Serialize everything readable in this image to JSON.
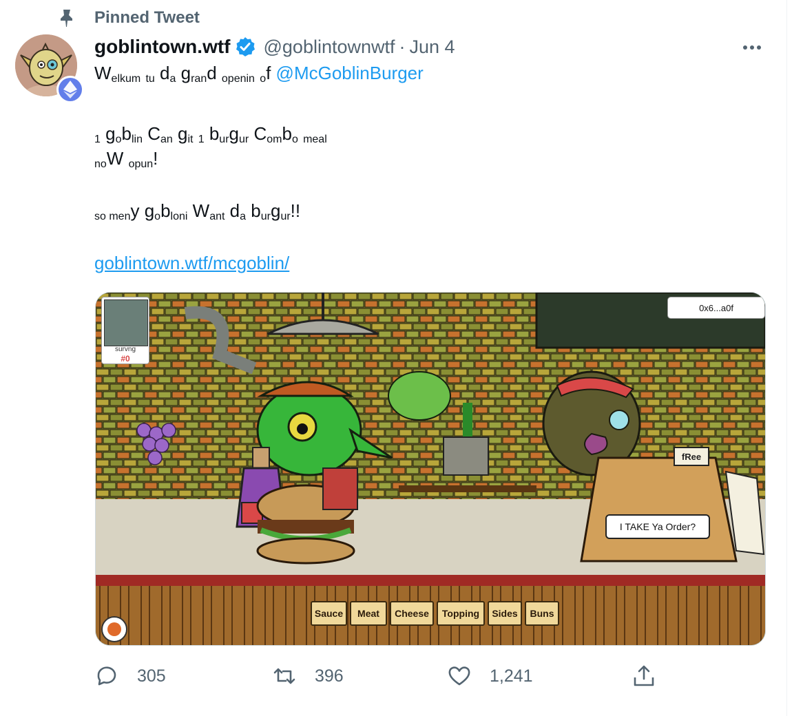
{
  "pinned": {
    "label": "Pinned Tweet",
    "icon": "pin-icon"
  },
  "author": {
    "display_name": "goblintown.wtf",
    "handle": "@goblintownwtf",
    "separator": "·",
    "date": "Jun 4",
    "verified": true,
    "avatar_badge": "ethereum-icon"
  },
  "tweet": {
    "mention": "@McGoblinBurger",
    "link": "goblintown.wtf/mcgoblin/"
  },
  "media": {
    "serving_label": "survng",
    "serving_number": "#0",
    "wallet_badge": "0x6...a0f",
    "register_sign": "fRee",
    "order_prompt": "I TAKE Ya Order?",
    "category_buttons": [
      "Sauce",
      "Meat",
      "Cheese",
      "Topping",
      "Sides",
      "Buns"
    ]
  },
  "actions": {
    "replies": "305",
    "retweets": "396",
    "likes": "1,241"
  },
  "colors": {
    "accent": "#1d9bf0",
    "secondary_text": "#536471",
    "verified": "#1d9bf0",
    "eth": "#627eea"
  }
}
